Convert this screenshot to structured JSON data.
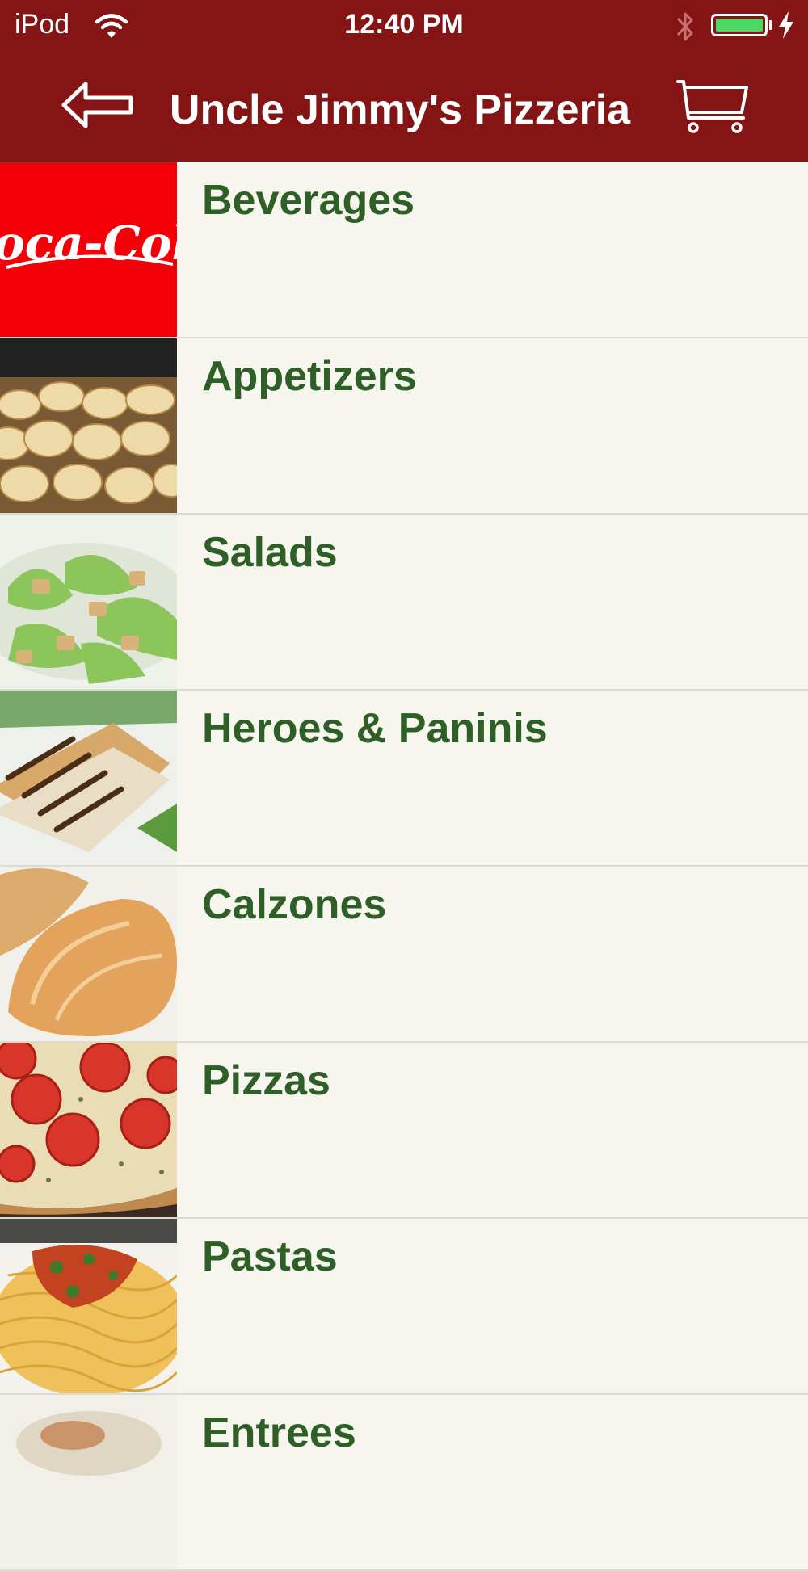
{
  "status": {
    "carrier": "iPod",
    "time": "12:40 PM"
  },
  "nav": {
    "title": "Uncle Jimmy's Pizzeria"
  },
  "thumbnails": {
    "beverages_logo": "Coca-Cola"
  },
  "colors": {
    "header": "#851515",
    "row_background": "#f7f6ee",
    "category_text": "#2d5f27",
    "battery": "#4cd964"
  },
  "icons": [
    "wifi-icon",
    "bluetooth-icon",
    "battery-icon",
    "charging-bolt-icon",
    "back-arrow-icon",
    "shopping-cart-icon"
  ],
  "categories": [
    {
      "label": "Beverages"
    },
    {
      "label": "Appetizers"
    },
    {
      "label": "Salads"
    },
    {
      "label": "Heroes & Paninis"
    },
    {
      "label": "Calzones"
    },
    {
      "label": "Pizzas"
    },
    {
      "label": "Pastas"
    },
    {
      "label": "Entrees"
    }
  ]
}
